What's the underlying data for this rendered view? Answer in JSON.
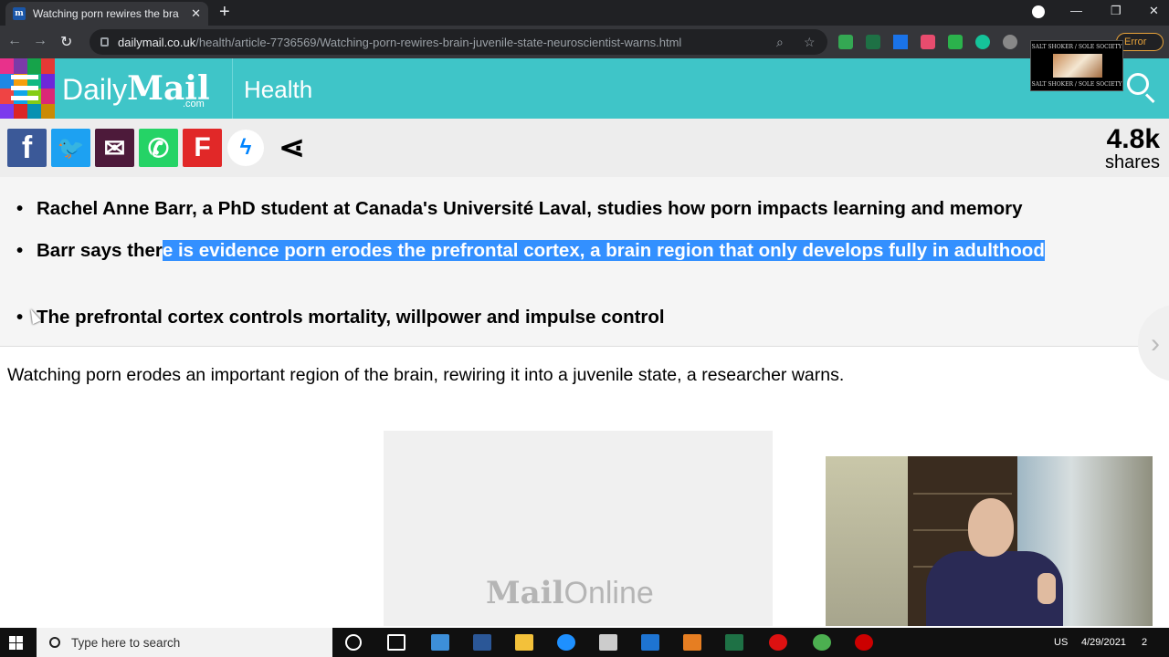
{
  "browser": {
    "tab_title": "Watching porn rewires the brain",
    "tab_close": "✕",
    "new_tab": "+",
    "url_host": "dailymail.co.uk",
    "url_path": "/health/article-7736569/Watching-porn-rewires-brain-juvenile-state-neuroscientist-warns.html",
    "error_label": "Error",
    "minimize": "—",
    "restore": "❐",
    "close": "✕"
  },
  "site": {
    "logo_daily": "Daily",
    "logo_mail": "Mail",
    "logo_com": ".com",
    "section": "Health"
  },
  "overlay_thumb": {
    "line_top": "SALT SHOKER / SOLE SOCIETY",
    "line_bottom": "SALT SHOKER / SOLE SOCIETY"
  },
  "share": {
    "buttons": [
      {
        "name": "facebook",
        "icon": "f",
        "color": "#3b5998"
      },
      {
        "name": "twitter",
        "icon": "🐦",
        "color": "#1da1f2"
      },
      {
        "name": "email",
        "icon": "✉",
        "color": "#4d1a3a"
      },
      {
        "name": "whatsapp",
        "icon": "✆",
        "color": "#25d366"
      },
      {
        "name": "flipboard",
        "icon": "F",
        "color": "#e12828"
      },
      {
        "name": "messenger",
        "icon": "ϟ",
        "color": "#ffffff"
      },
      {
        "name": "share-more",
        "icon": "⋖",
        "color": "#ededed"
      }
    ],
    "count": "4.8k",
    "count_label": "shares"
  },
  "bullets": {
    "b1": "Rachel Anne Barr, a PhD student at Canada's Université Laval, studies how porn impacts learning and memory",
    "b2_pre": "Barr says ther",
    "b2_hl": "e is evidence porn erodes the prefrontal cortex, a brain region that only develops fully in adulthood",
    "b3": "The prefrontal cortex controls mortality, willpower and impulse control"
  },
  "lead": "Watching porn erodes an important region of the brain, rewiring it into a juvenile state, a researcher warns.",
  "image_placeholder": {
    "mail": "Mail",
    "online": "Online"
  },
  "taskbar": {
    "search_placeholder": "Type here to search",
    "lang": "US",
    "date": "4/29/2021",
    "notif": "2"
  },
  "colors": {
    "header_teal": "#3fc5c8",
    "highlight": "#3390ff"
  }
}
